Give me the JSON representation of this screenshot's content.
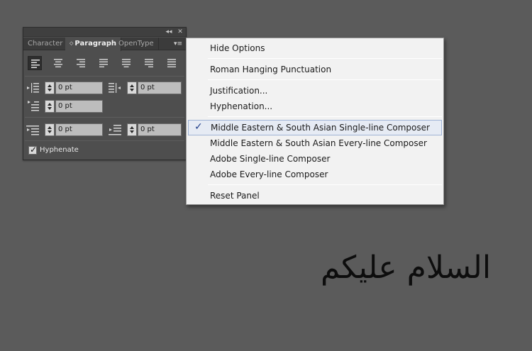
{
  "panel": {
    "topbar": {
      "collapse_glyph": "◂◂",
      "close_glyph": "✕"
    },
    "tabs": [
      {
        "label": "Character",
        "active": false
      },
      {
        "label": "Paragraph",
        "active": true,
        "arrows": "◇"
      },
      {
        "label": "OpenType",
        "active": false
      }
    ],
    "menu_glyph": "▾≡",
    "alignment_buttons": [
      {
        "name": "align-left",
        "active": true
      },
      {
        "name": "align-center",
        "active": false
      },
      {
        "name": "align-right",
        "active": false
      },
      {
        "name": "justify-last-left",
        "active": false
      },
      {
        "name": "justify-last-center",
        "active": false
      },
      {
        "name": "justify-last-right",
        "active": false
      },
      {
        "name": "justify-all",
        "active": false
      }
    ],
    "fields": {
      "left_indent": "0 pt",
      "right_indent": "0 pt",
      "first_line_indent": "0 pt",
      "space_before": "0 pt",
      "space_after": "0 pt"
    },
    "hyphenate": {
      "label": "Hyphenate",
      "checked": true,
      "check_glyph": "✓"
    }
  },
  "menu": {
    "items": [
      {
        "label": "Hide Options"
      },
      {
        "label": "Roman Hanging Punctuation"
      },
      {
        "label": "Justification..."
      },
      {
        "label": "Hyphenation..."
      },
      {
        "label": "Middle Eastern & South Asian Single-line Composer",
        "checked": true,
        "check_glyph": "✓"
      },
      {
        "label": "Middle Eastern & South Asian Every-line Composer"
      },
      {
        "label": "Adobe Single-line Composer"
      },
      {
        "label": "Adobe Every-line Composer"
      },
      {
        "label": "Reset Panel"
      }
    ]
  },
  "canvas": {
    "arabic_text": "السلام عليكم"
  },
  "colors": {
    "background": "#5b5b5b",
    "panel": "#4e4e4e",
    "menu": "#f2f2f2",
    "highlight": "#e6ebf4",
    "check": "#1f3d8a"
  }
}
